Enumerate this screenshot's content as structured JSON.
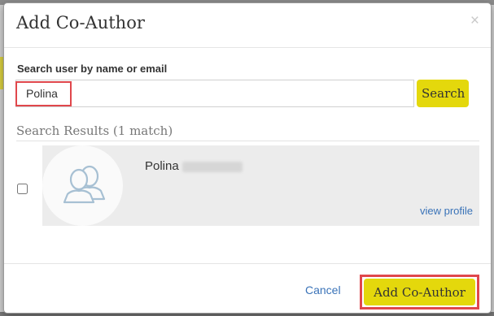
{
  "dialog": {
    "title": "Add Co-Author",
    "close_glyph": "×"
  },
  "search": {
    "label": "Search user by name or email",
    "value": "Polina",
    "button_label": "Search"
  },
  "results": {
    "heading": "Search Results (1 match)",
    "items": [
      {
        "first_name": "Polina",
        "view_profile_label": "view profile",
        "avatar_icon": "users-icon"
      }
    ]
  },
  "footer": {
    "cancel_label": "Cancel",
    "add_label": "Add Co-Author"
  },
  "colors": {
    "accent_button": "#e4d80c",
    "highlight_border": "#e0474c",
    "link": "#3a73b8"
  }
}
